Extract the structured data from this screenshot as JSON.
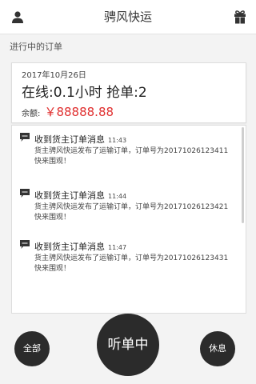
{
  "header": {
    "title": "骋风快运",
    "left_icon": "user-icon",
    "right_icon": "gift-icon"
  },
  "section_label": "进行中的订单",
  "summary": {
    "date": "2017年10月26日",
    "stats": "在线:0.1小时 抢单:2",
    "balance_label": "余额:",
    "balance_value": "￥88888.88",
    "balance_color": "#e03030"
  },
  "messages": [
    {
      "title": "收到货主订单消息",
      "time": "11:43",
      "body": "货主骋风快运发布了运输订单，订单号为20171026123411快来围观！"
    },
    {
      "title": "收到货主订单消息",
      "time": "11:44",
      "body": "货主骋风快运发布了运输订单，订单号为20171026123421快来围观！"
    },
    {
      "title": "收到货主订单消息",
      "time": "11:47",
      "body": "货主骋风快运发布了运输订单，订单号为20171026123431快来围观！"
    }
  ],
  "bottom": {
    "all": "全部",
    "main": "听单中",
    "rest": "休息"
  }
}
